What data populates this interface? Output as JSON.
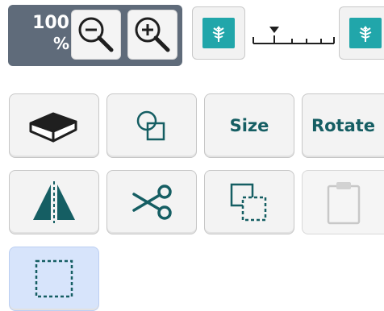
{
  "zoom": {
    "value": "100",
    "unit": "%",
    "zoom_out_icon": "zoom-out-icon",
    "zoom_in_icon": "zoom-in-icon"
  },
  "thumbnail_size": {
    "small_icon": "leaf-icon",
    "large_icon": "leaf-icon",
    "slider_icon": "slider-marker-icon"
  },
  "tools": {
    "eraser_icon": "eraser-icon",
    "shapes_icon": "shapes-icon",
    "size_label": "Size",
    "rotate_label": "Rotate",
    "mirror_icon": "mirror-icon",
    "cut_icon": "scissors-icon",
    "duplicate_icon": "duplicate-icon",
    "paste_icon": "clipboard-icon",
    "select_icon": "selection-rectangle-icon"
  },
  "colors": {
    "accent": "#155e63",
    "zoom_panel": "#5f6b7a",
    "thumbnail": "#21a6aa",
    "selected_background": "#d7e4fb"
  }
}
